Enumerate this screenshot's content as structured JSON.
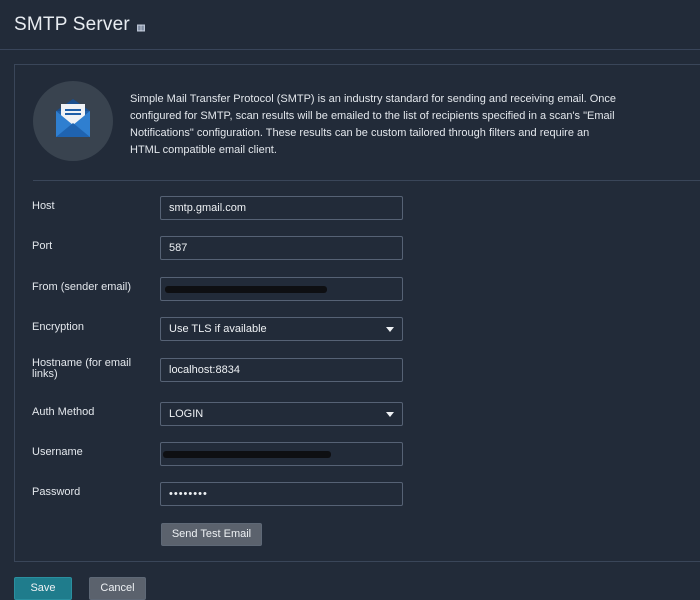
{
  "page": {
    "title": "SMTP Server"
  },
  "intro": {
    "description": "Simple Mail Transfer Protocol (SMTP) is an industry standard for sending and receiving email. Once configured for SMTP, scan results will be emailed to the list of recipients specified in a scan's \"Email Notifications\" configuration. These results can be custom tailored through filters and require an HTML compatible email client."
  },
  "form": {
    "host": {
      "label": "Host",
      "value": "smtp.gmail.com"
    },
    "port": {
      "label": "Port",
      "value": "587"
    },
    "from": {
      "label": "From (sender email)",
      "value": ""
    },
    "encryption": {
      "label": "Encryption",
      "value": "Use TLS if available"
    },
    "hostname": {
      "label": "Hostname (for email links)",
      "value": "localhost:8834"
    },
    "auth_method": {
      "label": "Auth Method",
      "value": "LOGIN"
    },
    "username": {
      "label": "Username",
      "value": ""
    },
    "password": {
      "label": "Password",
      "value": "••••••••"
    }
  },
  "buttons": {
    "send_test": "Send Test Email",
    "save": "Save",
    "cancel": "Cancel"
  },
  "colors": {
    "background": "#222b39",
    "save_button": "#1f7c8c",
    "secondary_button": "#5b626d",
    "envelope_blue": "#1f5fa8"
  }
}
